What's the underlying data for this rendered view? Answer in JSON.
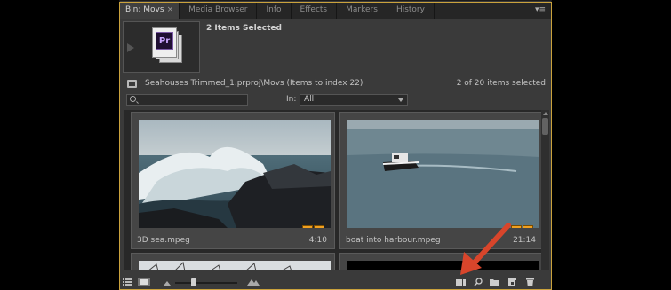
{
  "tabs": [
    {
      "label": "Bin: Movs",
      "close": "×",
      "active": true
    },
    {
      "label": "Media Browser"
    },
    {
      "label": "Info"
    },
    {
      "label": "Effects"
    },
    {
      "label": "Markers"
    },
    {
      "label": "History"
    }
  ],
  "tab_menu_icon": "panel-menu-icon",
  "header": {
    "selection_title": "2 Items Selected",
    "preview_logo_text": "Pr"
  },
  "path": {
    "text": "Seahouses Trimmed_1.prproj\\Movs (Items to index 22)",
    "count": "2 of 20 items selected"
  },
  "search": {
    "placeholder": "",
    "in_label": "In:",
    "in_value": "All"
  },
  "clips": [
    {
      "name": "3D sea.mpeg",
      "duration": "4:10"
    },
    {
      "name": "boat into harbour.mpeg",
      "duration": "21:14"
    }
  ],
  "colors": {
    "panel_bg": "#3a3a3a",
    "focus_border": "#caa23c",
    "annotation_arrow": "#d8452b",
    "badge": "#f0a020"
  },
  "bottom_icons": [
    "list-view-icon",
    "icon-view-icon",
    "zoom-slider-small-icon",
    "zoom-slider-large-icon",
    "automate-to-sequence-icon",
    "find-icon",
    "new-bin-icon",
    "new-item-icon",
    "trash-icon"
  ]
}
